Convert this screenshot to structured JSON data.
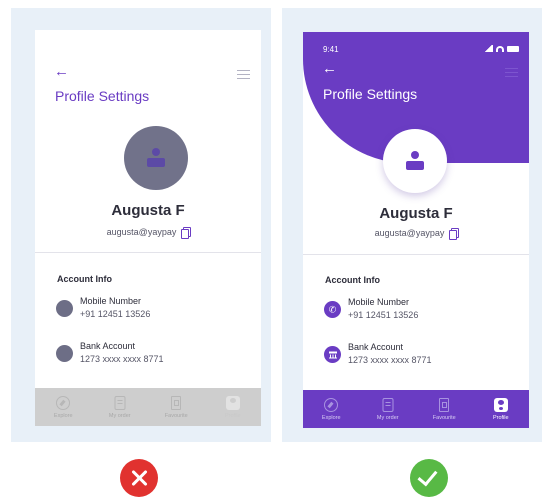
{
  "bad_example": {
    "screen": {
      "title": "Profile Settings",
      "name": "Augusta F",
      "email": "augusta@yaypay",
      "account_section": "Account Info",
      "mobile": {
        "label": "Mobile Number",
        "value": "+91 12451 13526",
        "icon": "phone-icon"
      },
      "bank": {
        "label": "Bank Account",
        "value": "1273 xxxx xxxx 8771",
        "icon": "bank-icon"
      },
      "nav": [
        {
          "label": "Explore",
          "icon": "compass-icon"
        },
        {
          "label": "My order",
          "icon": "document-icon"
        },
        {
          "label": "Favourite",
          "icon": "bookmark-icon"
        },
        {
          "label": "Profile",
          "icon": "profile-icon",
          "active": true
        }
      ]
    },
    "verdict_icon": "cross-icon",
    "verdict_color": "#e1322f"
  },
  "good_example": {
    "screen": {
      "status_time": "9:41",
      "title": "Profile Settings",
      "name": "Augusta F",
      "email": "augusta@yaypay",
      "account_section": "Account Info",
      "mobile": {
        "label": "Mobile Number",
        "value": "+91 12451 13526",
        "icon": "phone-icon"
      },
      "bank": {
        "label": "Bank Account",
        "value": "1273 xxxx xxxx 8771",
        "icon": "bank-icon"
      },
      "nav": [
        {
          "label": "Explore",
          "icon": "compass-icon"
        },
        {
          "label": "My order",
          "icon": "document-icon"
        },
        {
          "label": "Favourite",
          "icon": "bookmark-icon"
        },
        {
          "label": "Profile",
          "icon": "profile-icon",
          "active": true
        }
      ]
    },
    "verdict_icon": "check-icon",
    "verdict_color": "#58b945"
  },
  "colors": {
    "primary": "#6a3cc3",
    "panel_bg": "#e8f0f8",
    "avatar_gray": "#71728a",
    "nav_gray": "#cecece"
  }
}
